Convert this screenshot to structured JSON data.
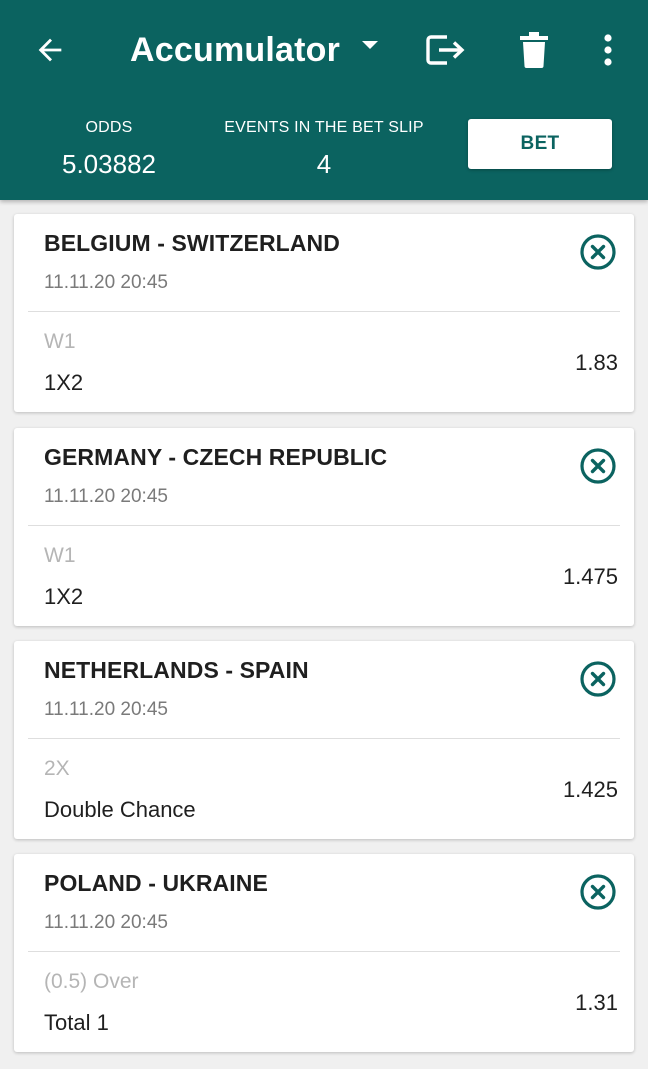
{
  "header": {
    "title": "Accumulator",
    "odds_label": "ODDS",
    "odds_value": "5.03882",
    "events_label": "EVENTS IN THE BET SLIP",
    "events_value": "4",
    "bet_label": "BET"
  },
  "icons": {
    "back": "arrow-left-icon",
    "dropdown": "caret-down-icon",
    "export": "export-icon",
    "delete": "trash-icon",
    "more": "more-vertical-icon",
    "remove": "close-circle-icon"
  },
  "colors": {
    "primary": "#0b6360",
    "background": "#f0f0f0",
    "card": "#ffffff",
    "text_primary": "#1f1f1f",
    "text_secondary": "#7a7a7a",
    "text_muted": "#b5b5b5"
  },
  "bets": [
    {
      "match": "BELGIUM - SWITZERLAND",
      "datetime": "11.11.20 20:45",
      "outcome": "W1",
      "market": "1X2",
      "coef": "1.83"
    },
    {
      "match": "GERMANY - CZECH REPUBLIC",
      "datetime": "11.11.20 20:45",
      "outcome": "W1",
      "market": "1X2",
      "coef": "1.475"
    },
    {
      "match": "NETHERLANDS - SPAIN",
      "datetime": "11.11.20 20:45",
      "outcome": "2X",
      "market": "Double Chance",
      "coef": "1.425"
    },
    {
      "match": "POLAND - UKRAINE",
      "datetime": "11.11.20 20:45",
      "outcome": "(0.5) Over",
      "market": "Total 1",
      "coef": "1.31"
    }
  ]
}
